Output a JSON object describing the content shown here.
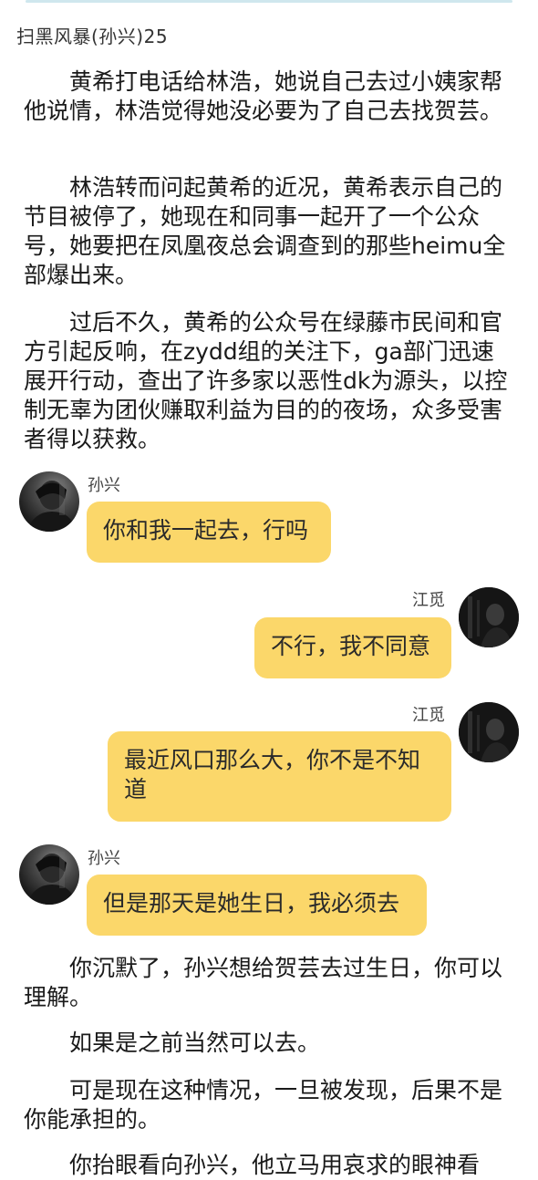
{
  "chapter": {
    "title": "扫黑风暴(孙兴)25"
  },
  "paragraphs": [
    "黄希打电话给林浩，她说自己去过小姨家帮他说情，林浩觉得她没必要为了自己去找贺芸。",
    "林浩转而问起黄希的近况，黄希表示自己的节目被停了，她现在和同事一起开了一个公众号，她要把在凤凰夜总会调查到的那些heimu全部爆出来。",
    "过后不久，黄希的公众号在绿藤市民间和官方引起反响，在zydd组的关注下，ga部门迅速展开行动，查出了许多家以恶性dk为源头，以控制无辜为团伙赚取利益为目的的夜场，众多受害者得以获救。"
  ],
  "chat": [
    {
      "speaker": "孙兴",
      "side": "left",
      "text": "你和我一起去，行吗"
    },
    {
      "speaker": "江觅",
      "side": "right",
      "text": "不行，我不同意"
    },
    {
      "speaker": "江觅",
      "side": "right",
      "text": "最近风口那么大，你不是不知道"
    },
    {
      "speaker": "孙兴",
      "side": "left",
      "text": "但是那天是她生日，我必须去"
    }
  ],
  "after_paragraphs": [
    "你沉默了，孙兴想给贺芸去过生日，你可以理解。",
    "如果是之前当然可以去。",
    "可是现在这种情况，一旦被发现，后果不是你能承担的。",
    "你抬眼看向孙兴，他立马用哀求的眼神看"
  ],
  "colors": {
    "bubble": "#fbd76a",
    "top_line": "#cfe7ee"
  },
  "icons": {
    "avatar_left": "avatar-sunxing-icon",
    "avatar_right": "avatar-jiangmi-icon"
  }
}
